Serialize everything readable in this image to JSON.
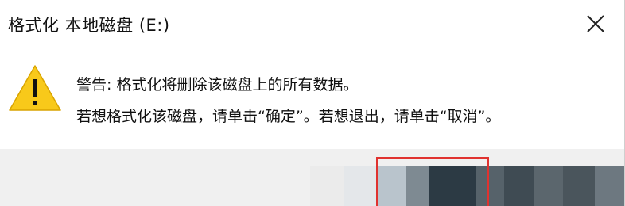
{
  "dialog": {
    "title": "格式化 本地磁盘 (E:)",
    "close_icon": "close-icon",
    "warning_icon": "warning-icon",
    "message_line1": "警告: 格式化将删除该磁盘上的所有数据。",
    "message_line2": "若想格式化该磁盘，请单击“确定”。若想退出，请单击“取消”。"
  },
  "colors": {
    "warning_fill": "#f8c91a",
    "highlight_border": "#e0322f",
    "footer_bg": "#f0f0f0"
  }
}
